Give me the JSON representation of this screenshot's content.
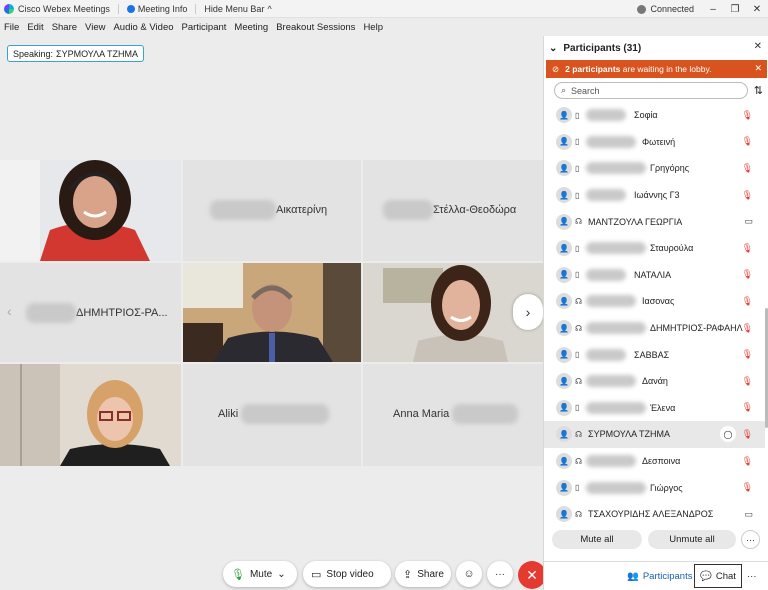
{
  "titlebar": {
    "app_name": "Cisco Webex Meetings",
    "meeting_info": "Meeting Info",
    "hide_menu": "Hide Menu Bar",
    "connection": "Connected",
    "chevron": "^",
    "minimize": "–",
    "restore": "❐",
    "close": "✕"
  },
  "menu": [
    "File",
    "Edit",
    "Share",
    "View",
    "Audio & Video",
    "Participant",
    "Meeting",
    "Breakout Sessions",
    "Help"
  ],
  "speaking": {
    "label": "Speaking:",
    "name": "ΣΥΡΜΟΥΛΑ ΤΖΗΜΑ"
  },
  "tiles": {
    "t2_name": "Αικατερίνη",
    "t3_name": "Στέλλα-Θεοδώρα",
    "t4_name": "ΔΗΜΗΤΡΙΟΣ-ΡΑ...",
    "t8_name": "Aliki",
    "t9_name": "Anna Maria"
  },
  "nav": {
    "left": "‹",
    "right": "›"
  },
  "controls": {
    "mute": "Mute",
    "stop_video": "Stop video",
    "share": "Share",
    "more": "···",
    "end_icon": "✕",
    "mic_icon": "🎙",
    "chevron": "⌄",
    "video_icon": "▭",
    "share_icon": "⇪",
    "emoji_icon": "☺"
  },
  "panel": {
    "title": "Participants (31)",
    "collapse_icon": "⌄",
    "close": "✕",
    "lobby_icon": "⊘",
    "lobby_bold": "2 participants",
    "lobby_text": " are waiting in the lobby.",
    "search_placeholder": "Search",
    "search_icon": "⌕",
    "sort_icon": "⇅",
    "mute_all": "Mute all",
    "unmute_all": "Unmute all",
    "more": "···",
    "participants_tab": "Participants",
    "chat_tab": "Chat",
    "footer_more": "···",
    "people_icon": "👥",
    "chat_icon": "💬"
  },
  "participants": [
    {
      "name": "Σοφία",
      "device": "phone",
      "blurred": true,
      "muted": true,
      "video": false
    },
    {
      "name": "Φωτεινή",
      "device": "phone",
      "blurred": true,
      "muted": true,
      "video": false
    },
    {
      "name": "Γρηγόρης",
      "device": "phone",
      "blurred": true,
      "muted": true,
      "video": false
    },
    {
      "name": "Ιωάννης Γ3",
      "device": "phone",
      "blurred": true,
      "muted": true,
      "video": false
    },
    {
      "name": "ΜΑΝΤΖΟΥΛΑ ΓΕΩΡΓΙΑ",
      "device": "headset",
      "blurred": false,
      "muted": false,
      "video": true
    },
    {
      "name": "Σταυρούλα",
      "device": "phone",
      "blurred": true,
      "muted": true,
      "video": false
    },
    {
      "name": "ΝΑΤΑΛΙΑ",
      "device": "phone",
      "blurred": true,
      "muted": true,
      "video": false
    },
    {
      "name": "Ιασονας",
      "device": "headset",
      "blurred": true,
      "muted": true,
      "video": false
    },
    {
      "name": "ΔΗΜΗΤΡΙΟΣ-ΡΑΦΑΗΛ",
      "device": "headset",
      "blurred": true,
      "muted": true,
      "video": false
    },
    {
      "name": "ΣΑΒΒΑΣ",
      "device": "phone",
      "blurred": true,
      "muted": true,
      "video": false
    },
    {
      "name": "Δανάη",
      "device": "headset",
      "blurred": true,
      "muted": true,
      "video": false
    },
    {
      "name": "Έλενα",
      "device": "phone",
      "blurred": true,
      "muted": true,
      "video": false
    },
    {
      "name": "ΣΥΡΜΟΥΛΑ ΤΖΗΜΑ",
      "device": "headset",
      "blurred": false,
      "muted": true,
      "video": false,
      "chat": true
    },
    {
      "name": "Δεσποινα",
      "device": "headset",
      "blurred": true,
      "muted": true,
      "video": false
    },
    {
      "name": "Γιώργος",
      "device": "phone",
      "blurred": true,
      "muted": true,
      "video": false
    },
    {
      "name": "ΤΣΑΧΟΥΡΙΔΗΣ ΑΛΕΞΑΝΔΡΟΣ",
      "device": "headset",
      "blurred": false,
      "muted": false,
      "video": true
    }
  ],
  "colors": {
    "accent": "#1a5fb4",
    "lobby": "#d9531e",
    "end": "#e53a2f"
  }
}
